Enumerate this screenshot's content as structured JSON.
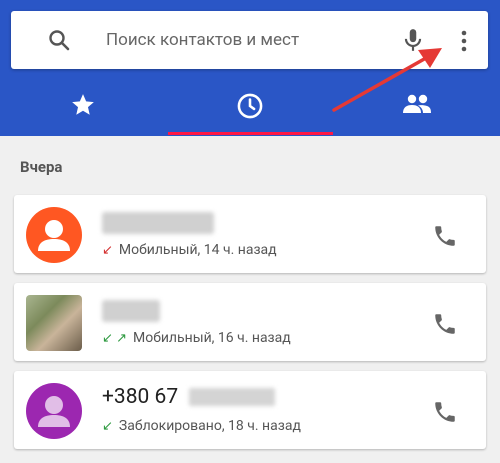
{
  "search": {
    "placeholder": "Поиск контактов и мест"
  },
  "tabs": [
    {
      "name": "favorites",
      "icon": "star-icon"
    },
    {
      "name": "recent",
      "icon": "clock-icon",
      "active": true
    },
    {
      "name": "contacts",
      "icon": "people-icon"
    }
  ],
  "section_title": "Вчера",
  "calls": [
    {
      "name": "",
      "avatar_color": "#ff5722",
      "arrow": "↙",
      "arrow_color": "#d32f2f",
      "details": "Мобильный, 14 ч. назад"
    },
    {
      "name": "",
      "avatar_color": "#8d9a6e",
      "arrow": "↙ ↗",
      "arrow_color": "#2e9a40",
      "details": "Мобильный, 16 ч. назад"
    },
    {
      "name": "+380 67",
      "avatar_color": "#9c27b0",
      "arrow": "↙",
      "arrow_color": "#2e9a40",
      "details": "Заблокировано, 18 ч. назад"
    }
  ],
  "colors": {
    "header": "#2a56c6",
    "indicator": "#ff1744",
    "annotation_arrow": "#e53935"
  }
}
